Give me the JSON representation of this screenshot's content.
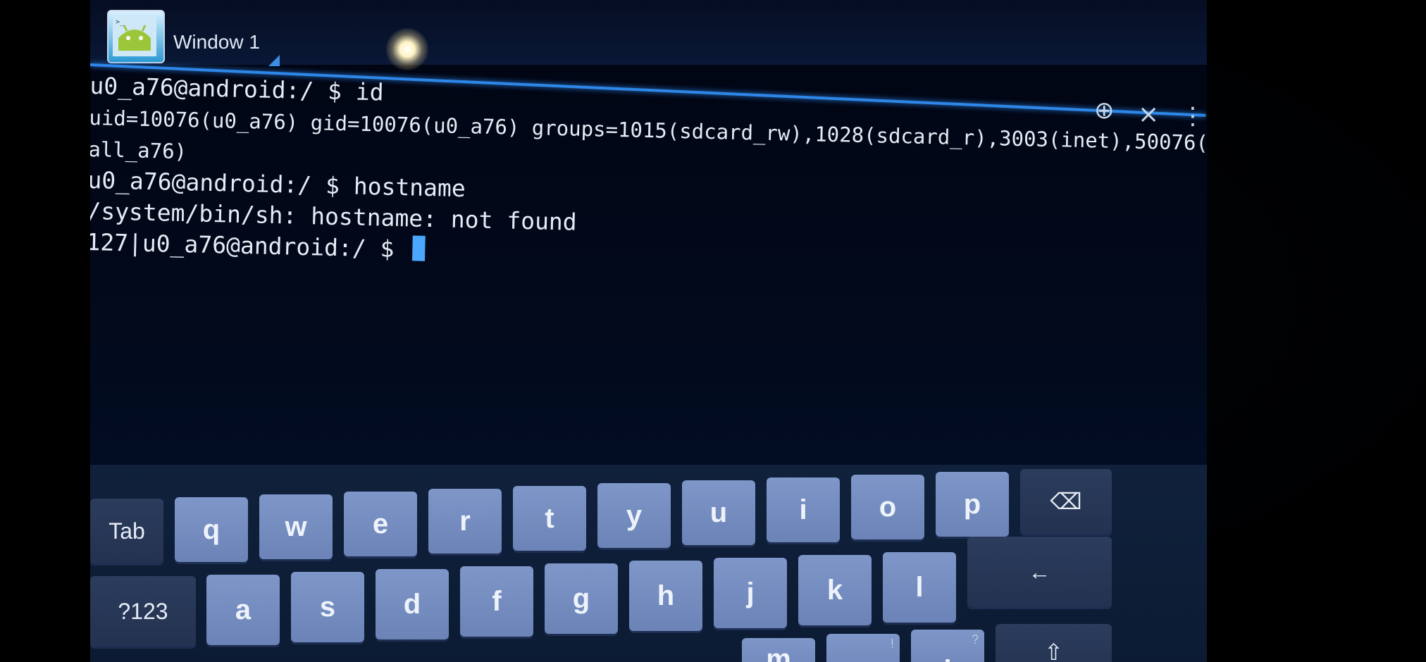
{
  "tab": {
    "label": "Window 1"
  },
  "toolbar": {
    "new_window_icon": "⊕",
    "close_window_icon": "×",
    "overflow_menu_icon": "⋮"
  },
  "terminal": {
    "lines": [
      "u0_a76@android:/ $ id",
      "uid=10076(u0_a76) gid=10076(u0_a76) groups=1015(sdcard_rw),1028(sdcard_r),3003(inet),50076(",
      "all_a76)",
      "u0_a76@android:/ $ hostname",
      "/system/bin/sh: hostname: not found",
      "127|u0_a76@android:/ $ "
    ]
  },
  "keyboard": {
    "row1": [
      "q",
      "w",
      "e",
      "r",
      "t",
      "y",
      "u",
      "i",
      "o",
      "p"
    ],
    "row2": [
      "a",
      "s",
      "d",
      "f",
      "g",
      "h",
      "j",
      "k",
      "l"
    ],
    "row3": [
      "m",
      ",",
      "."
    ],
    "row3_hints": [
      "!",
      "?"
    ],
    "tab_label": "Tab",
    "symbols_label": "?123",
    "backspace_icon": "⌫",
    "enter_icon": "←",
    "shift_icon": "⇧"
  },
  "colors": {
    "tab_underline": "#2e87e8",
    "cursor": "#4aa6ff",
    "key_face": "#7e96c8"
  }
}
